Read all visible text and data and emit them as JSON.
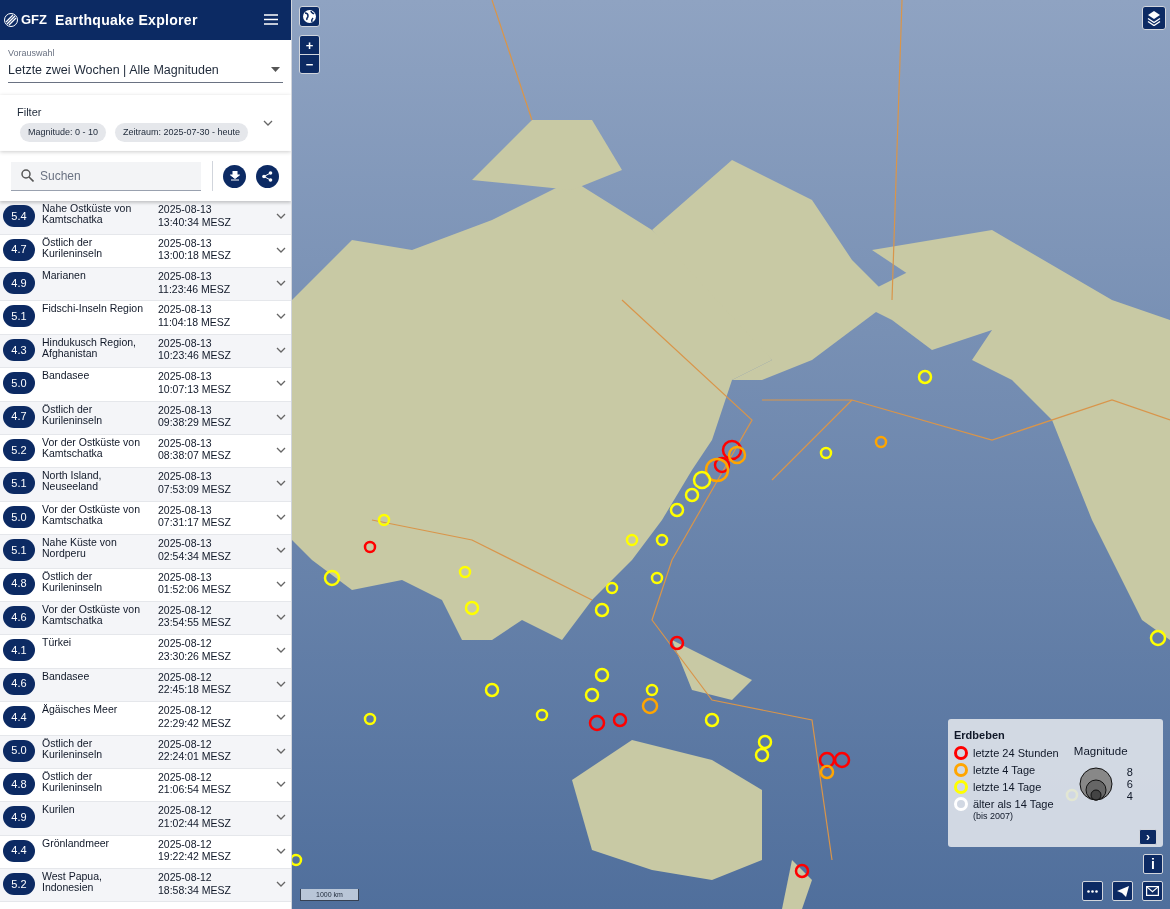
{
  "header": {
    "logo": "GFZ",
    "title": "Earthquake Explorer"
  },
  "preset": {
    "label": "Vorauswahl",
    "value": "Letzte zwei Wochen | Alle Magnituden"
  },
  "filter": {
    "title": "Filter",
    "chips": [
      "Magnitude: 0 - 10",
      "Zeitraum: 2025-07-30 - heute"
    ]
  },
  "search": {
    "placeholder": "Suchen"
  },
  "events": [
    {
      "mag": "5.4",
      "region": "Nahe Ostküste von Kamtschatka",
      "date": "2025-08-13",
      "time": "13:40:34 MESZ"
    },
    {
      "mag": "4.7",
      "region": "Östlich der Kurileninseln",
      "date": "2025-08-13",
      "time": "13:00:18 MESZ"
    },
    {
      "mag": "4.9",
      "region": "Marianen",
      "date": "2025-08-13",
      "time": "11:23:46 MESZ"
    },
    {
      "mag": "5.1",
      "region": "Fidschi-Inseln Region",
      "date": "2025-08-13",
      "time": "11:04:18 MESZ"
    },
    {
      "mag": "4.3",
      "region": "Hindukusch Region, Afghanistan",
      "date": "2025-08-13",
      "time": "10:23:46 MESZ"
    },
    {
      "mag": "5.0",
      "region": "Bandasee",
      "date": "2025-08-13",
      "time": "10:07:13 MESZ"
    },
    {
      "mag": "4.7",
      "region": "Östlich der Kurileninseln",
      "date": "2025-08-13",
      "time": "09:38:29 MESZ"
    },
    {
      "mag": "5.2",
      "region": "Vor der Ostküste von Kamtschatka",
      "date": "2025-08-13",
      "time": "08:38:07 MESZ"
    },
    {
      "mag": "5.1",
      "region": "North Island, Neuseeland",
      "date": "2025-08-13",
      "time": "07:53:09 MESZ"
    },
    {
      "mag": "5.0",
      "region": "Vor der Ostküste von Kamtschatka",
      "date": "2025-08-13",
      "time": "07:31:17 MESZ"
    },
    {
      "mag": "5.1",
      "region": "Nahe Küste von Nordperu",
      "date": "2025-08-13",
      "time": "02:54:34 MESZ"
    },
    {
      "mag": "4.8",
      "region": "Östlich der Kurileninseln",
      "date": "2025-08-13",
      "time": "01:52:06 MESZ"
    },
    {
      "mag": "4.6",
      "region": "Vor der Ostküste von Kamtschatka",
      "date": "2025-08-12",
      "time": "23:54:55 MESZ"
    },
    {
      "mag": "4.1",
      "region": "Türkei",
      "date": "2025-08-12",
      "time": "23:30:26 MESZ"
    },
    {
      "mag": "4.6",
      "region": "Bandasee",
      "date": "2025-08-12",
      "time": "22:45:18 MESZ"
    },
    {
      "mag": "4.4",
      "region": "Ägäisches Meer",
      "date": "2025-08-12",
      "time": "22:29:42 MESZ"
    },
    {
      "mag": "5.0",
      "region": "Östlich der Kurileninseln",
      "date": "2025-08-12",
      "time": "22:24:01 MESZ"
    },
    {
      "mag": "4.8",
      "region": "Östlich der Kurileninseln",
      "date": "2025-08-12",
      "time": "21:06:54 MESZ"
    },
    {
      "mag": "4.9",
      "region": "Kurilen",
      "date": "2025-08-12",
      "time": "21:02:44 MESZ"
    },
    {
      "mag": "4.4",
      "region": "Grönlandmeer",
      "date": "2025-08-12",
      "time": "19:22:42 MESZ"
    },
    {
      "mag": "5.2",
      "region": "West Papua, Indonesien",
      "date": "2025-08-12",
      "time": "18:58:34 MESZ"
    }
  ],
  "map": {
    "zoom_in": "+",
    "zoom_out": "−",
    "scale": "1000 km"
  },
  "legend": {
    "title": "Erdbeben",
    "items": [
      {
        "label": "letzte 24 Stunden",
        "color": "#ff0000"
      },
      {
        "label": "letzte 4 Tage",
        "color": "#ffa500"
      },
      {
        "label": "letzte 14 Tage",
        "color": "#ffff00"
      },
      {
        "label": "älter als 14 Tage",
        "note": "(bis 2007)",
        "color": "#ffffff"
      }
    ],
    "magnitude_title": "Magnitude",
    "magnitudes": [
      "8",
      "6",
      "4"
    ],
    "expand": "›",
    "info": "i"
  }
}
